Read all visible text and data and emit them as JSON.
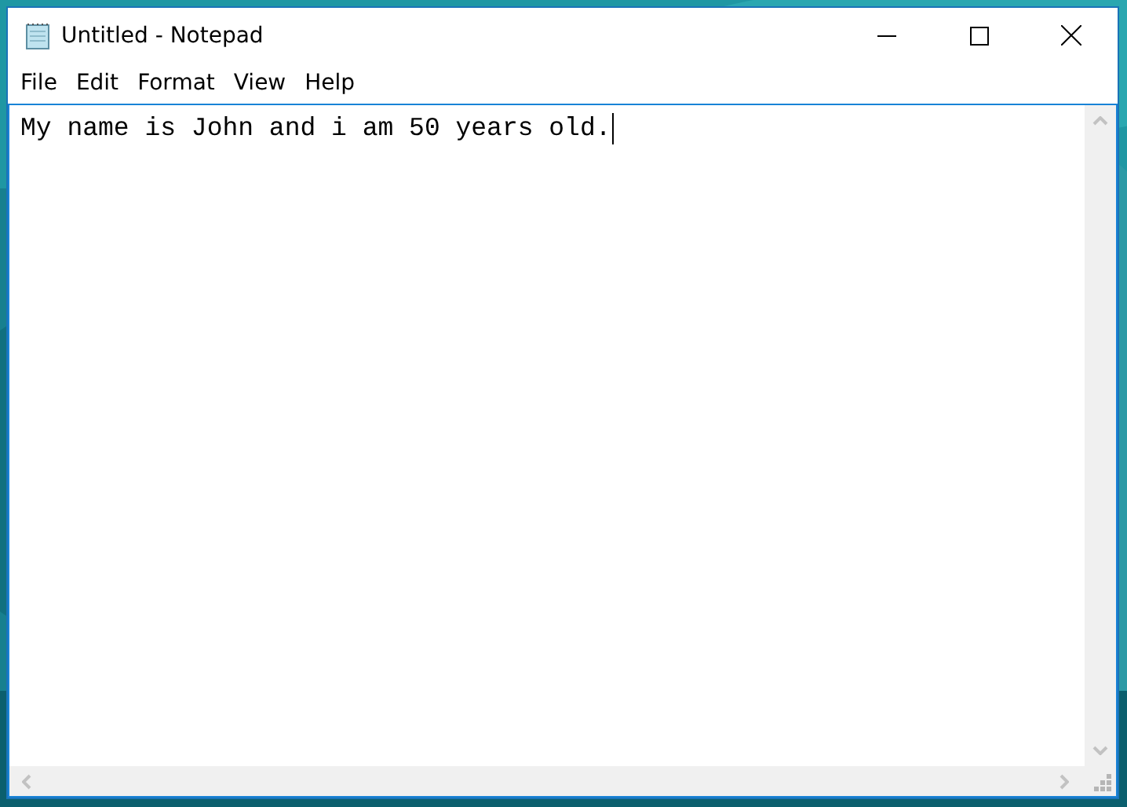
{
  "window": {
    "title": "Untitled - Notepad"
  },
  "menu": [
    {
      "label": "File"
    },
    {
      "label": "Edit"
    },
    {
      "label": "Format"
    },
    {
      "label": "View"
    },
    {
      "label": "Help"
    }
  ],
  "document": {
    "text": "My name is John and i am 50 years old.",
    "caret_visible": true
  }
}
